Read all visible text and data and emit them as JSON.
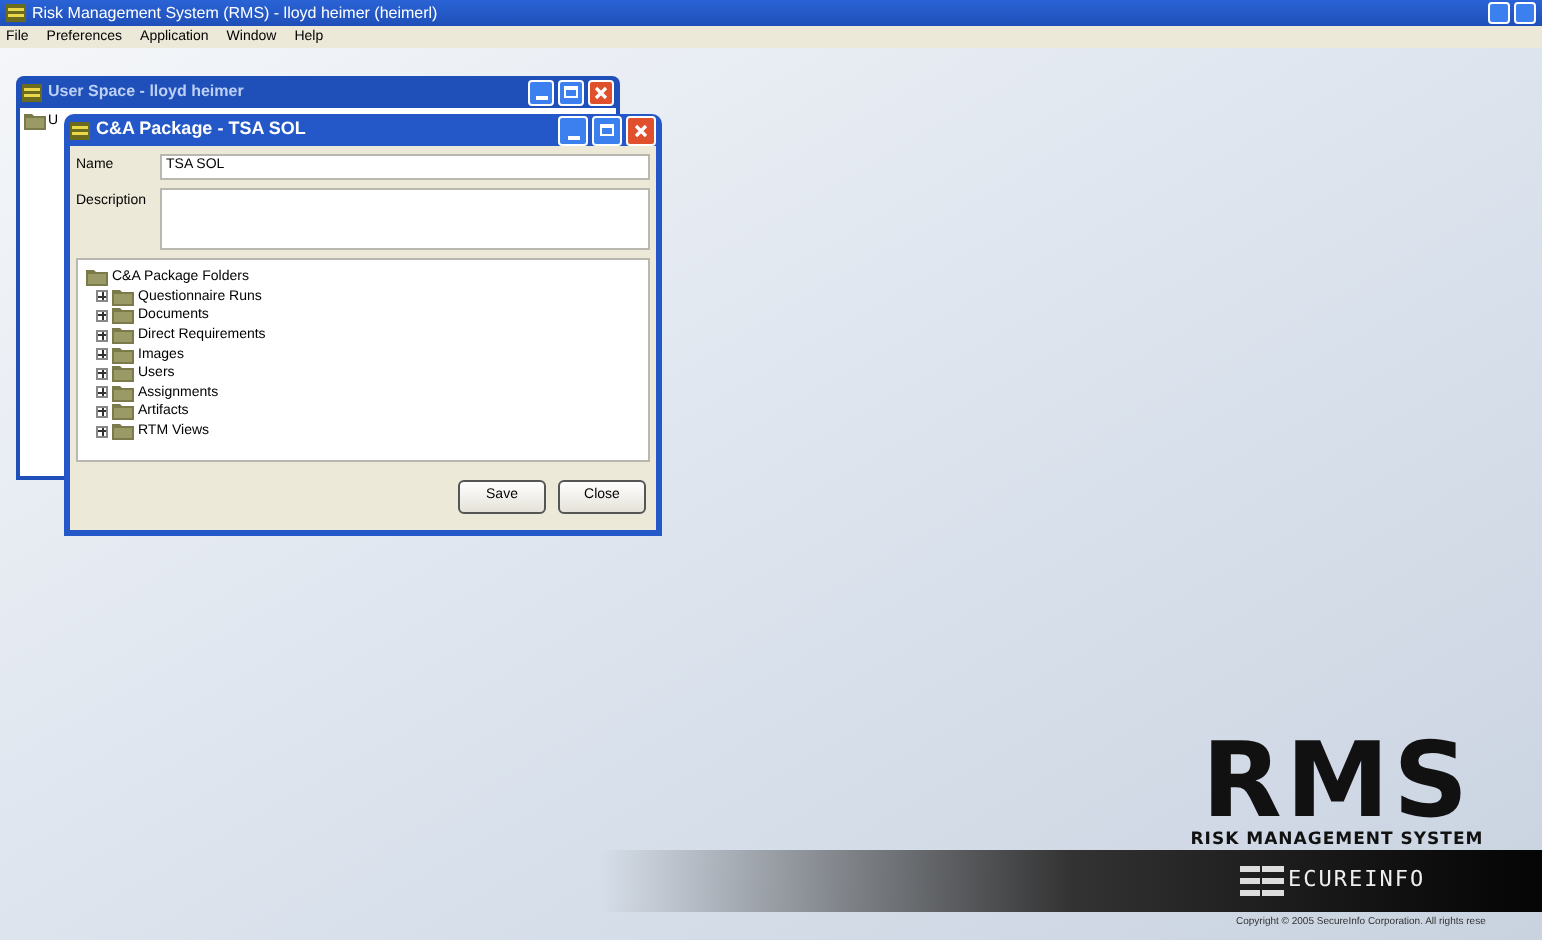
{
  "window": {
    "title": "Risk Management System (RMS) - lloyd heimer (heimerl)"
  },
  "menu": [
    "File",
    "Preferences",
    "Application",
    "Window",
    "Help"
  ],
  "user_space": {
    "title": "User Space - lloyd heimer",
    "tree_label": "U"
  },
  "dialog": {
    "title": "C&A Package - TSA SOL",
    "name_label": "Name",
    "name_value": "TSA SOL",
    "description_label": "Description",
    "tree": {
      "label": "C&A Package Folders",
      "children": [
        {
          "label": "Questionnaire Runs",
          "expanded": false
        },
        {
          "label": "Documents",
          "expanded": false
        },
        {
          "label": "Direct Requirements",
          "expanded": false
        },
        {
          "label": "Images",
          "expanded": false
        },
        {
          "label": "Users",
          "expanded": false
        },
        {
          "label": "Assignments",
          "expanded": false
        },
        {
          "label": "Artifacts",
          "expanded": false
        },
        {
          "label": "RTM Views",
          "expanded": false
        }
      ]
    },
    "buttons": [
      "Save",
      "Close"
    ]
  },
  "branding": {
    "logo": "RMS",
    "tagline": "RISK MANAGEMENT SYSTEM",
    "company": "ECUREINFO",
    "copyright": "Copyright © 2005 SecureInfo Corporation. All rights rese"
  }
}
